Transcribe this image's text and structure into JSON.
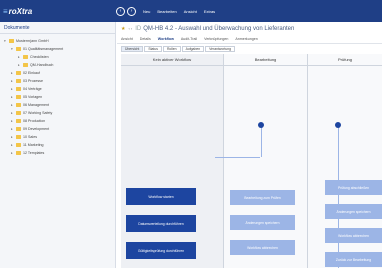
{
  "app": {
    "logo_mark": "≡",
    "logo_text": "roXtra"
  },
  "topbar": {
    "back_glyph": "‹",
    "forward_glyph": "›",
    "menu": [
      "Neu",
      "Bearbeiten",
      "Ansicht",
      "Extras"
    ]
  },
  "sidebar": {
    "title": "Dokumente",
    "items": [
      {
        "label": "Musterm(ann GmbH",
        "toggle": "▾"
      },
      {
        "label": "01 Qualitätsmanagement",
        "toggle": "▾"
      },
      {
        "label": "Checklisten",
        "toggle": "▸"
      },
      {
        "label": "QM-Handbuch",
        "toggle": "▸"
      },
      {
        "label": "02 Einkauf",
        "toggle": "▸"
      },
      {
        "label": "03 Prozesse",
        "toggle": "▸"
      },
      {
        "label": "04 Verträge",
        "toggle": "▸"
      },
      {
        "label": "05 Vorlagen",
        "toggle": "▸"
      },
      {
        "label": "06 Management",
        "toggle": "▸"
      },
      {
        "label": "07 Working Safety",
        "toggle": "▸"
      },
      {
        "label": "08 Production",
        "toggle": "▸"
      },
      {
        "label": "09 Development",
        "toggle": "▸"
      },
      {
        "label": "10 Sales",
        "toggle": "▸"
      },
      {
        "label": "11 Marketing",
        "toggle": "▸"
      },
      {
        "label": "12 Templates",
        "toggle": "▸"
      }
    ]
  },
  "breadcrumb": {
    "star": "★",
    "arrows": "‹ ›",
    "id": "ID",
    "title": "QM-HB 4.2 - Auswahl und Überwachung von Lieferanten"
  },
  "tabs": [
    "Ansicht",
    "Details",
    "Workflow",
    "Audit-Trail",
    "Verknüpfungen",
    "Anmerkungen"
  ],
  "active_tab": "Workflow",
  "subtabs": [
    "Übersicht",
    "Status",
    "Rollen",
    "Aufgaben",
    "Verantwortung"
  ],
  "lanes": [
    "Kein aktiver Workflow",
    "Bearbeitung",
    "Prüfung"
  ],
  "workflow": {
    "start": "Workflow starten",
    "auto_start": "Datumsverteilung durchführen",
    "due_date": "Gültigkeitsprüfung durchführen",
    "edit_release": "Bearbeitung zum Prüfen",
    "save": "Änderungen speichern",
    "cancel": "Workflow abbrechen",
    "review_done": "Prüfung abschließen",
    "review_save": "Änderungen speichern",
    "review_cancel": "Workflow abbrechen",
    "back_to_edit": "Zurück zur Bearbeitung"
  },
  "colors": {
    "topbar": "#1f3f86",
    "action_dark": "#1d45a0",
    "action_light": "#9cb5e6"
  }
}
